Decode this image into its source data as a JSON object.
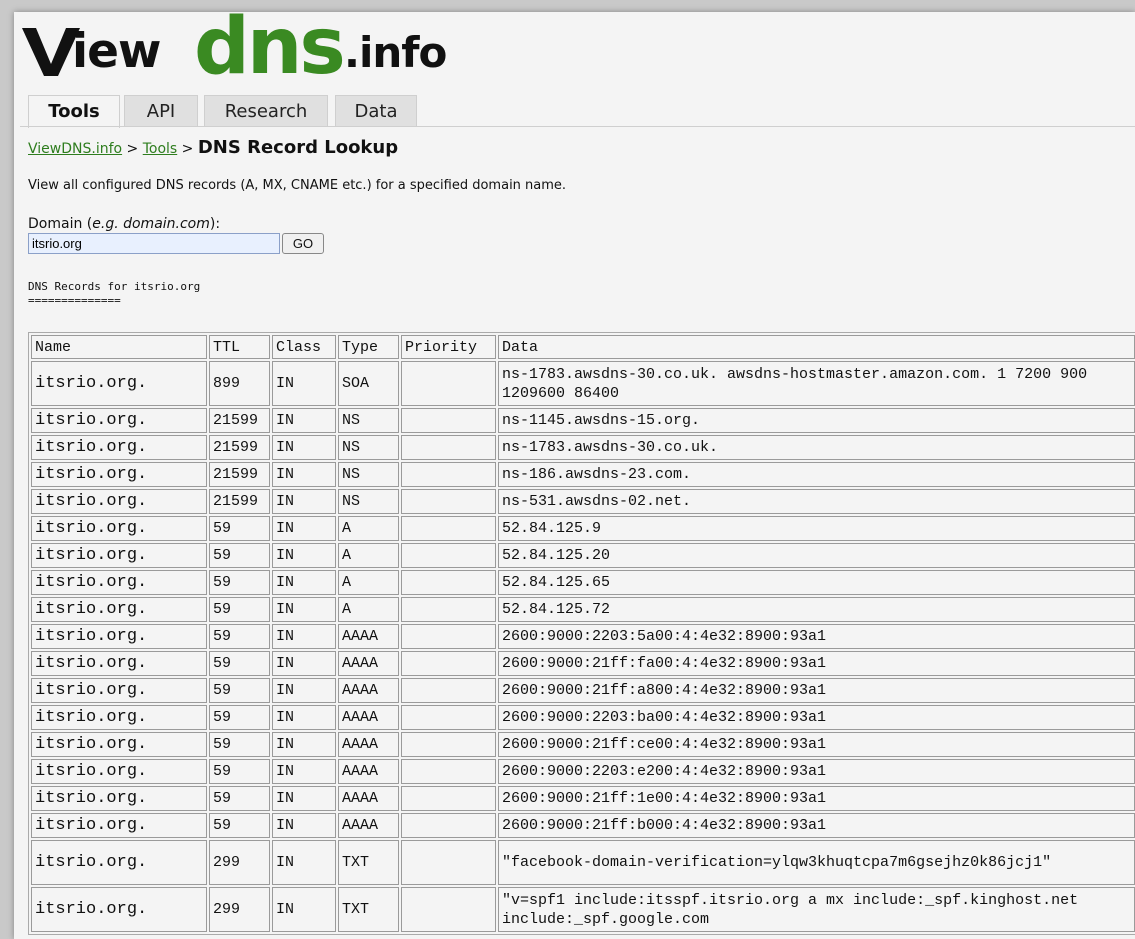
{
  "logo": {
    "v": "V",
    "iew": "iew",
    "dns": "dns",
    "info": ".info"
  },
  "tabs": [
    {
      "label": "Tools",
      "active": true
    },
    {
      "label": "API",
      "active": false
    },
    {
      "label": "Research",
      "active": false
    },
    {
      "label": "Data",
      "active": false
    }
  ],
  "breadcrumb": {
    "home": "ViewDNS.info",
    "sep1": ">",
    "tools": "Tools",
    "sep2": ">",
    "current": "DNS Record Lookup"
  },
  "description": "View all configured DNS records (A, MX, CNAME etc.) for a specified domain name.",
  "domain_label": {
    "prefix": "Domain (",
    "example": "e.g. domain.com",
    "suffix": "):"
  },
  "domain_input": {
    "value": "itsrio.org"
  },
  "go_button": "GO",
  "results_title": "DNS Records for itsrio.org",
  "results_underline": "==============",
  "table": {
    "headers": [
      "Name",
      "TTL",
      "Class",
      "Type",
      "Priority",
      "Data"
    ],
    "rows": [
      [
        "itsrio.org.",
        "899",
        "IN",
        "SOA",
        "",
        "ns-1783.awsdns-30.co.uk. awsdns-hostmaster.amazon.com. 1 7200 900 1209600 86400"
      ],
      [
        "itsrio.org.",
        "21599",
        "IN",
        "NS",
        "",
        "ns-1145.awsdns-15.org."
      ],
      [
        "itsrio.org.",
        "21599",
        "IN",
        "NS",
        "",
        "ns-1783.awsdns-30.co.uk."
      ],
      [
        "itsrio.org.",
        "21599",
        "IN",
        "NS",
        "",
        "ns-186.awsdns-23.com."
      ],
      [
        "itsrio.org.",
        "21599",
        "IN",
        "NS",
        "",
        "ns-531.awsdns-02.net."
      ],
      [
        "itsrio.org.",
        "59",
        "IN",
        "A",
        "",
        "52.84.125.9"
      ],
      [
        "itsrio.org.",
        "59",
        "IN",
        "A",
        "",
        "52.84.125.20"
      ],
      [
        "itsrio.org.",
        "59",
        "IN",
        "A",
        "",
        "52.84.125.65"
      ],
      [
        "itsrio.org.",
        "59",
        "IN",
        "A",
        "",
        "52.84.125.72"
      ],
      [
        "itsrio.org.",
        "59",
        "IN",
        "AAAA",
        "",
        "2600:9000:2203:5a00:4:4e32:8900:93a1"
      ],
      [
        "itsrio.org.",
        "59",
        "IN",
        "AAAA",
        "",
        "2600:9000:21ff:fa00:4:4e32:8900:93a1"
      ],
      [
        "itsrio.org.",
        "59",
        "IN",
        "AAAA",
        "",
        "2600:9000:21ff:a800:4:4e32:8900:93a1"
      ],
      [
        "itsrio.org.",
        "59",
        "IN",
        "AAAA",
        "",
        "2600:9000:2203:ba00:4:4e32:8900:93a1"
      ],
      [
        "itsrio.org.",
        "59",
        "IN",
        "AAAA",
        "",
        "2600:9000:21ff:ce00:4:4e32:8900:93a1"
      ],
      [
        "itsrio.org.",
        "59",
        "IN",
        "AAAA",
        "",
        "2600:9000:2203:e200:4:4e32:8900:93a1"
      ],
      [
        "itsrio.org.",
        "59",
        "IN",
        "AAAA",
        "",
        "2600:9000:21ff:1e00:4:4e32:8900:93a1"
      ],
      [
        "itsrio.org.",
        "59",
        "IN",
        "AAAA",
        "",
        "2600:9000:21ff:b000:4:4e32:8900:93a1"
      ],
      [
        "itsrio.org.",
        "299",
        "IN",
        "TXT",
        "",
        "\"facebook-domain-verification=ylqw3khuqtcpa7m6gsejhz0k86jcj1\""
      ],
      [
        "itsrio.org.",
        "299",
        "IN",
        "TXT",
        "",
        "\"v=spf1 include:itsspf.itsrio.org a mx include:_spf.kinghost.net include:_spf.google.com"
      ]
    ]
  },
  "colors": {
    "link": "#2e7d1e",
    "logo_green": "#3a8a22",
    "page_bg": "#f4f4f4"
  }
}
